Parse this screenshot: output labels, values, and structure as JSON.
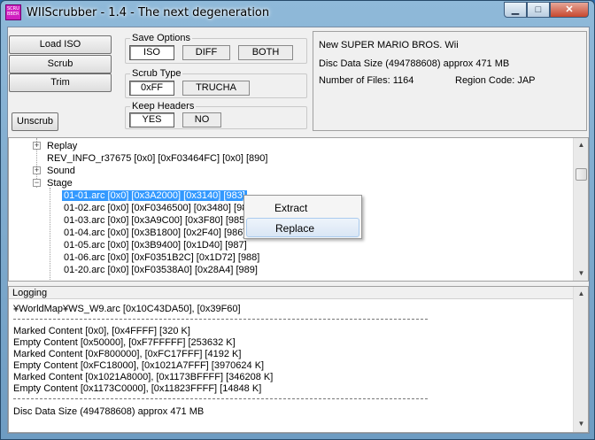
{
  "window": {
    "title": "WIIScrubber - 1.4 - The next degeneration",
    "icon_text": "SCRU BBER",
    "controls": {
      "minimize": "▁",
      "maximize": "□",
      "close": "✕"
    }
  },
  "buttons": {
    "load_iso": "Load ISO",
    "scrub": "Scrub",
    "trim": "Trim",
    "unscrub": "Unscrub"
  },
  "save_options": {
    "label": "Save Options",
    "options": [
      {
        "label": "ISO",
        "selected": true
      },
      {
        "label": "DIFF",
        "selected": false
      },
      {
        "label": "BOTH",
        "selected": false
      }
    ]
  },
  "scrub_type": {
    "label": "Scrub Type",
    "options": [
      {
        "label": "0xFF",
        "selected": true
      },
      {
        "label": "TRUCHA",
        "selected": false
      }
    ]
  },
  "keep_headers": {
    "label": "Keep Headers",
    "options": [
      {
        "label": "YES",
        "selected": true
      },
      {
        "label": "NO",
        "selected": false
      }
    ]
  },
  "info": {
    "game_title": "New SUPER MARIO BROS. Wii",
    "disc_data_size": "Disc Data Size (494788608) approx  471 MB",
    "number_of_files": "Number of Files: 1164",
    "region_code": "Region Code: JAP"
  },
  "tree": {
    "rows": [
      {
        "text": "Replay",
        "expander": "+"
      },
      {
        "text": "REV_INFO_r37675 [0x0] [0xF03464FC] [0x0] [890]",
        "expander": ""
      },
      {
        "text": "Sound",
        "expander": "+"
      },
      {
        "text": "Stage",
        "expander": "−"
      },
      {
        "text": "01-01.arc [0x0] [0x3A2000] [0x3140] [983]",
        "selected": true
      },
      {
        "text": "01-02.arc [0x0] [0xF0346500] [0x3480] [984]"
      },
      {
        "text": "01-03.arc [0x0] [0x3A9C00] [0x3F80] [985]"
      },
      {
        "text": "01-04.arc [0x0] [0x3B1800] [0x2F40] [986]"
      },
      {
        "text": "01-05.arc [0x0] [0x3B9400] [0x1D40] [987]"
      },
      {
        "text": "01-06.arc [0x0] [0xF0351B2C] [0x1D72] [988]"
      },
      {
        "text": "01-20.arc [0x0] [0xF03538A0] [0x28A4] [989]"
      }
    ]
  },
  "context_menu": {
    "items": [
      {
        "label": "Extract",
        "hover": false
      },
      {
        "label": "Replace",
        "hover": true
      }
    ]
  },
  "logging": {
    "header": "Logging",
    "lines": [
      "¥WorldMap¥WS_W9.arc [0x10C43DA50], [0x39F60]",
      "Marked Content [0x0], [0x4FFFF] [320 K]",
      "Empty Content [0x50000], [0xF7FFFFF] [253632 K]",
      "Marked Content [0xF800000], [0xFC17FFF] [4192 K]",
      "Empty Content [0xFC18000], [0x1021A7FFF] [3970624 K]",
      "Marked Content [0x1021A8000], [0x1173BFFFF] [346208 K]",
      "Empty Content [0x1173C0000], [0x11823FFFF] [14848 K]",
      "Disc Data Size (494788608) approx  471 MB"
    ]
  }
}
